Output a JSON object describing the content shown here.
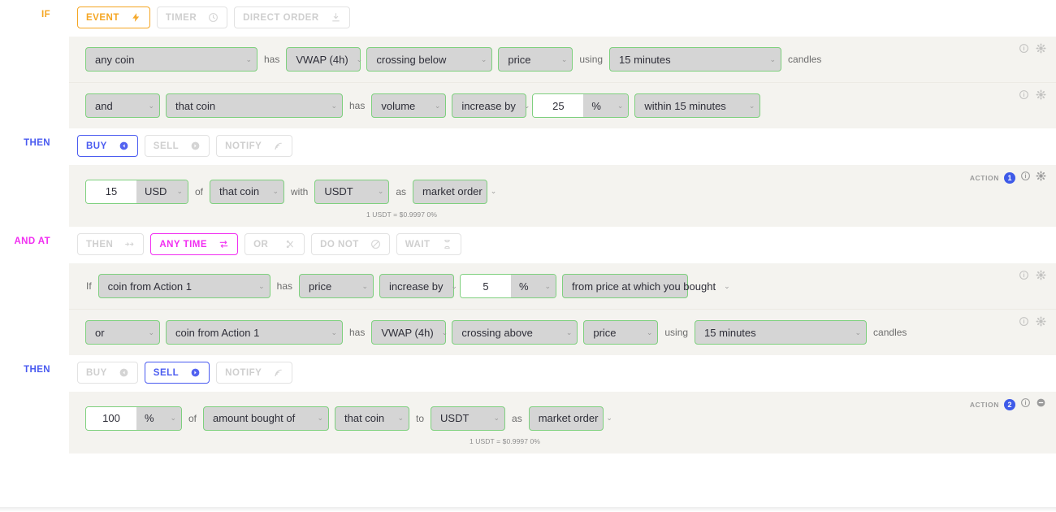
{
  "blocks": [
    {
      "label": "IF",
      "accent": "#f5a623",
      "tabs": [
        {
          "label": "EVENT",
          "icon": "lightning-icon",
          "active": true
        },
        {
          "label": "TIMER",
          "icon": "clock-icon",
          "active": false
        },
        {
          "label": "DIRECT ORDER",
          "icon": "download-icon",
          "active": false
        }
      ],
      "rows": [
        {
          "name": "condition-row-1",
          "parts": [
            {
              "kind": "select",
              "name": "coin-select",
              "value": "any coin",
              "width": "w-wide"
            },
            {
              "kind": "word",
              "name": "word-has",
              "value": "has"
            },
            {
              "kind": "select",
              "name": "indicator-select",
              "value": "VWAP (4h)",
              "width": "w-sm"
            },
            {
              "kind": "select",
              "name": "comparator-select",
              "value": "crossing below",
              "width": "w-med"
            },
            {
              "kind": "select",
              "name": "target-select",
              "value": "price",
              "width": "w-sm"
            },
            {
              "kind": "word",
              "name": "word-using",
              "value": "using"
            },
            {
              "kind": "select",
              "name": "candle-interval-select",
              "value": "15 minutes",
              "width": "w-wide"
            },
            {
              "kind": "word",
              "name": "word-candles",
              "value": "candles"
            }
          ],
          "tools": [
            "info-icon",
            "gear-icon"
          ]
        },
        {
          "name": "condition-row-2",
          "parts": [
            {
              "kind": "select",
              "name": "logic-operator-select",
              "value": "and",
              "width": "w-sm"
            },
            {
              "kind": "select",
              "name": "coin-select",
              "value": "that coin",
              "width": "w-wide2"
            },
            {
              "kind": "word",
              "name": "word-has",
              "value": "has"
            },
            {
              "kind": "select",
              "name": "metric-select",
              "value": "volume",
              "width": "w-sm"
            },
            {
              "kind": "select",
              "name": "change-direction-select",
              "value": "increase by",
              "width": "w-sm"
            },
            {
              "kind": "numunit",
              "name": "change-amount-input",
              "number": "25",
              "unit": "%"
            },
            {
              "kind": "select",
              "name": "timeframe-select",
              "value": "within 15 minutes",
              "width": "w-med"
            }
          ],
          "tools": [
            "info-icon",
            "gear-icon"
          ]
        }
      ]
    },
    {
      "label": "THEN",
      "accent": "#4a5bf0",
      "tabs": [
        {
          "label": "BUY",
          "icon": "arrow-left-circle-icon",
          "active": true
        },
        {
          "label": "SELL",
          "icon": "arrow-right-circle-icon",
          "active": false
        },
        {
          "label": "NOTIFY",
          "icon": "broadcast-icon",
          "active": false
        }
      ],
      "rows": [
        {
          "name": "buy-action-row",
          "action_tag": {
            "label": "ACTION",
            "number": "1"
          },
          "tools": [
            "info-icon",
            "gear-icon"
          ],
          "sub_note": "1 USDT = $0.9997 0%",
          "parts": [
            {
              "kind": "numunit",
              "name": "buy-amount-input",
              "number": "15",
              "unit": "USD"
            },
            {
              "kind": "word",
              "name": "word-of",
              "value": "of"
            },
            {
              "kind": "select",
              "name": "buy-coin-select",
              "value": "that coin",
              "width": "w-sm"
            },
            {
              "kind": "word",
              "name": "word-with",
              "value": "with"
            },
            {
              "kind": "select",
              "name": "pay-currency-select",
              "value": "USDT",
              "width": "w-sm"
            },
            {
              "kind": "word",
              "name": "word-as",
              "value": "as"
            },
            {
              "kind": "select",
              "name": "order-type-select",
              "value": "market order",
              "width": "w-sm"
            }
          ]
        }
      ]
    },
    {
      "label": "AND AT",
      "accent": "#f12ef1",
      "tabs": [
        {
          "label": "THEN",
          "icon": "arrows-right-icon",
          "active": false
        },
        {
          "label": "ANY TIME",
          "icon": "swap-icon",
          "active": true
        },
        {
          "label": "OR",
          "icon": "branch-icon",
          "active": false
        },
        {
          "label": "DO NOT",
          "icon": "ban-icon",
          "active": false
        },
        {
          "label": "WAIT",
          "icon": "hourglass-icon",
          "active": false
        }
      ],
      "rows": [
        {
          "name": "exit-condition-row-1",
          "parts": [
            {
              "kind": "word",
              "name": "word-if",
              "value": "If"
            },
            {
              "kind": "select",
              "name": "coin-from-action-select",
              "value": "coin from Action 1",
              "width": "w-wide"
            },
            {
              "kind": "word",
              "name": "word-has",
              "value": "has"
            },
            {
              "kind": "select",
              "name": "metric-select",
              "value": "price",
              "width": "w-sm"
            },
            {
              "kind": "select",
              "name": "change-direction-select",
              "value": "increase by",
              "width": "w-sm"
            },
            {
              "kind": "numunit",
              "name": "change-amount-input",
              "number": "5",
              "unit": "%"
            },
            {
              "kind": "select",
              "name": "reference-price-select",
              "value": "from price at which you bought",
              "width": "w-med"
            }
          ],
          "tools": [
            "info-icon",
            "gear-icon"
          ]
        },
        {
          "name": "exit-condition-row-2",
          "parts": [
            {
              "kind": "select",
              "name": "logic-operator-select",
              "value": "or",
              "width": "w-sm"
            },
            {
              "kind": "select",
              "name": "coin-from-action-select",
              "value": "coin from Action 1",
              "width": "w-wide2"
            },
            {
              "kind": "word",
              "name": "word-has",
              "value": "has"
            },
            {
              "kind": "select",
              "name": "indicator-select",
              "value": "VWAP (4h)",
              "width": "w-sm"
            },
            {
              "kind": "select",
              "name": "comparator-select",
              "value": "crossing above",
              "width": "w-med"
            },
            {
              "kind": "select",
              "name": "target-select",
              "value": "price",
              "width": "w-sm"
            },
            {
              "kind": "word",
              "name": "word-using",
              "value": "using"
            },
            {
              "kind": "select",
              "name": "candle-interval-select",
              "value": "15 minutes",
              "width": "w-wide"
            },
            {
              "kind": "word",
              "name": "word-candles",
              "value": "candles"
            }
          ],
          "tools": [
            "info-icon",
            "gear-icon"
          ]
        }
      ]
    },
    {
      "label": "THEN",
      "accent": "#4a5bf0",
      "tabs": [
        {
          "label": "BUY",
          "icon": "arrow-left-circle-icon",
          "active": false
        },
        {
          "label": "SELL",
          "icon": "arrow-right-circle-icon",
          "active": true
        },
        {
          "label": "NOTIFY",
          "icon": "broadcast-icon",
          "active": false
        }
      ],
      "rows": [
        {
          "name": "sell-action-row",
          "action_tag": {
            "label": "ACTION",
            "number": "2"
          },
          "tools": [
            "info-icon",
            "minus-circle-icon"
          ],
          "sub_note": "1 USDT = $0.9997 0%",
          "parts": [
            {
              "kind": "numunit",
              "name": "sell-amount-input",
              "number": "100",
              "unit": "%"
            },
            {
              "kind": "word",
              "name": "word-of",
              "value": "of"
            },
            {
              "kind": "select",
              "name": "sell-basis-select",
              "value": "amount bought of",
              "width": "w-med"
            },
            {
              "kind": "select",
              "name": "sell-coin-select",
              "value": "that coin",
              "width": "w-sm"
            },
            {
              "kind": "word",
              "name": "word-to",
              "value": "to"
            },
            {
              "kind": "select",
              "name": "receive-currency-select",
              "value": "USDT",
              "width": "w-sm"
            },
            {
              "kind": "word",
              "name": "word-as",
              "value": "as"
            },
            {
              "kind": "select",
              "name": "order-type-select",
              "value": "market order",
              "width": "w-sm"
            }
          ]
        }
      ]
    }
  ],
  "colors": {
    "accent_if": "#f5a623",
    "accent_then": "#4a5bf0",
    "accent_andat": "#f12ef1",
    "select_border": "#7ed07e",
    "select_fill": "#d5d5d5",
    "panel_bg": "#f4f3ef",
    "badge": "#3e5ae8"
  }
}
